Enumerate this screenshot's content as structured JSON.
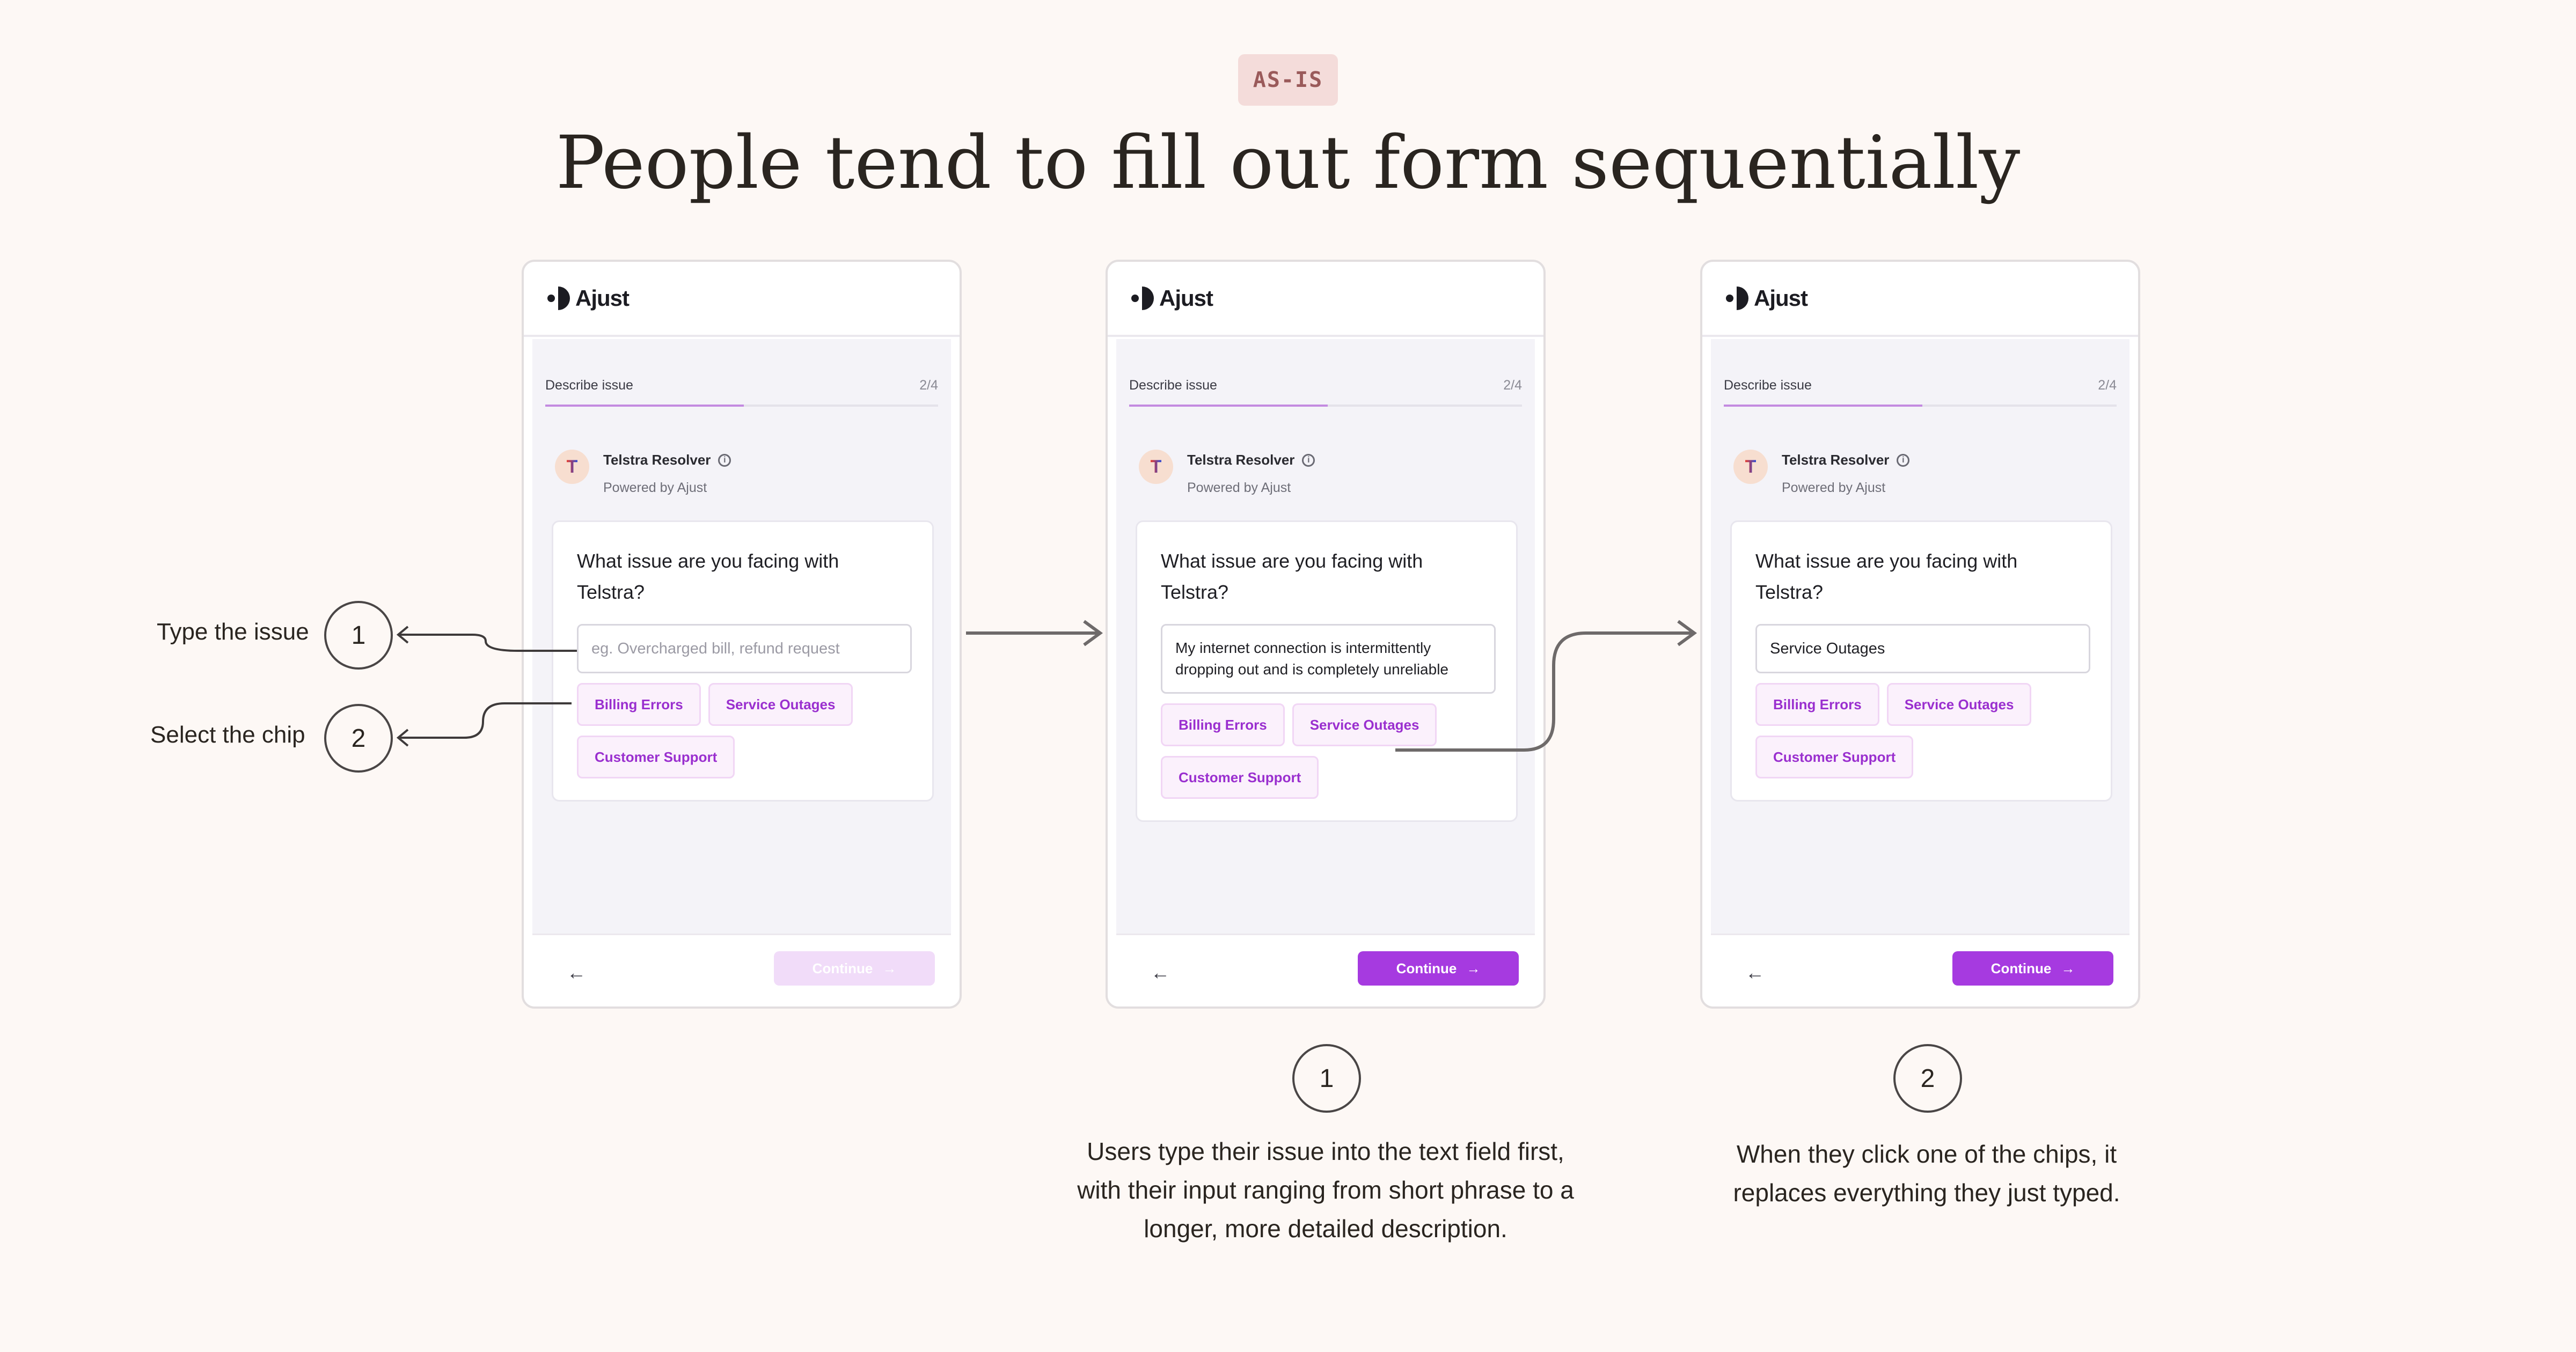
{
  "header": {
    "tag": "AS-IS",
    "title": "People tend to fill out form sequentially"
  },
  "annotations": {
    "type_label": "Type the issue",
    "type_num": "1",
    "select_label": "Select the chip",
    "select_num": "2"
  },
  "app": {
    "brand": "Ajust",
    "step_label": "Describe issue",
    "step_count": "2/4",
    "resolver_name": "Telstra Resolver",
    "resolver_sub": "Powered by Ajust",
    "avatar_letter": "T",
    "question": "What issue are you facing with Telstra?",
    "continue_label": "Continue",
    "colors": {
      "accent": "#a63ae0",
      "chip_text": "#9a2fcf",
      "disabled": "#f1dcf9"
    }
  },
  "screens": [
    {
      "input": "",
      "placeholder": "eg. Overcharged bill, refund request",
      "chips": [
        "Billing Errors",
        "Service Outages",
        "Customer Support"
      ]
    },
    {
      "input": "My internet connection is intermittently dropping out and is completely unreliable",
      "chips": [
        "Billing Errors",
        "Service Outages",
        "Customer Support"
      ]
    },
    {
      "input": "Service Outages",
      "chips": [
        "Billing Errors",
        "Service Outages",
        "Customer Support"
      ]
    }
  ],
  "captions": [
    {
      "num": "1",
      "text": "Users type their issue into the text field first, with their input ranging from short phrase to a longer, more detailed description."
    },
    {
      "num": "2",
      "text": "When they click one of the chips, it replaces everything they just typed."
    }
  ]
}
